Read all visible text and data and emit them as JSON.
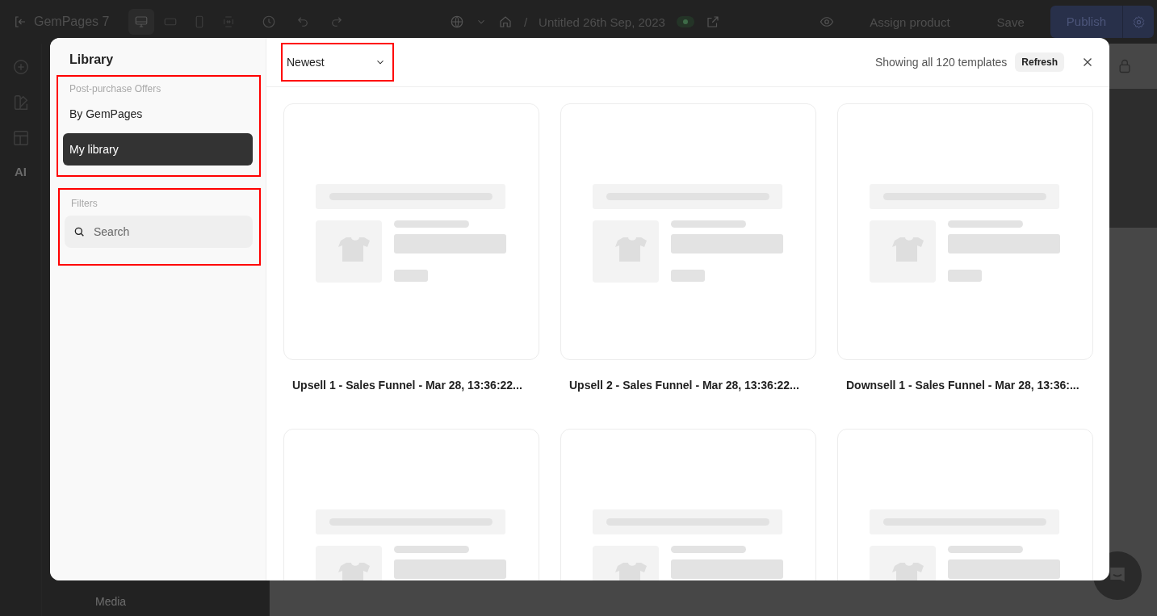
{
  "topbar": {
    "app_name": "GemPages 7",
    "devices": [
      {
        "kind": "desktop",
        "selected": true
      },
      {
        "kind": "tablet",
        "selected": false
      },
      {
        "kind": "mobile",
        "selected": false
      },
      {
        "kind": "fit",
        "selected": false
      }
    ],
    "separator": "/",
    "page_title": "Untitled 26th Sep, 2023",
    "published": true,
    "assign": "Assign product",
    "save": "Save",
    "publish": "Publish"
  },
  "rail": {
    "ai_label": "AI"
  },
  "left_panel": {
    "item": "Media"
  },
  "library": {
    "title": "Library",
    "sections": [
      {
        "heading": "Post-purchase Offers",
        "highlighted": true,
        "items": [
          {
            "label": "By GemPages",
            "selected": false
          },
          {
            "label": "My library",
            "selected": true
          }
        ]
      }
    ],
    "filters": {
      "heading": "Filters",
      "highlighted": true,
      "search": {
        "placeholder": "Search"
      }
    },
    "sort": {
      "value": "Newest",
      "highlighted": true
    },
    "count": "Showing all 120 templates",
    "refresh": "Refresh",
    "templates": [
      {
        "kind": "full",
        "name": "Upsell 1 - Sales Funnel - Mar 28, 13:36:22..."
      },
      {
        "kind": "full",
        "name": "Upsell 2 - Sales Funnel - Mar 28, 13:36:22..."
      },
      {
        "kind": "full",
        "name": "Downsell 1 - Sales Funnel - Mar 28, 13:36:..."
      },
      {
        "kind": "cut-off"
      },
      {
        "kind": "cut-off"
      },
      {
        "kind": "cut-off"
      }
    ]
  }
}
